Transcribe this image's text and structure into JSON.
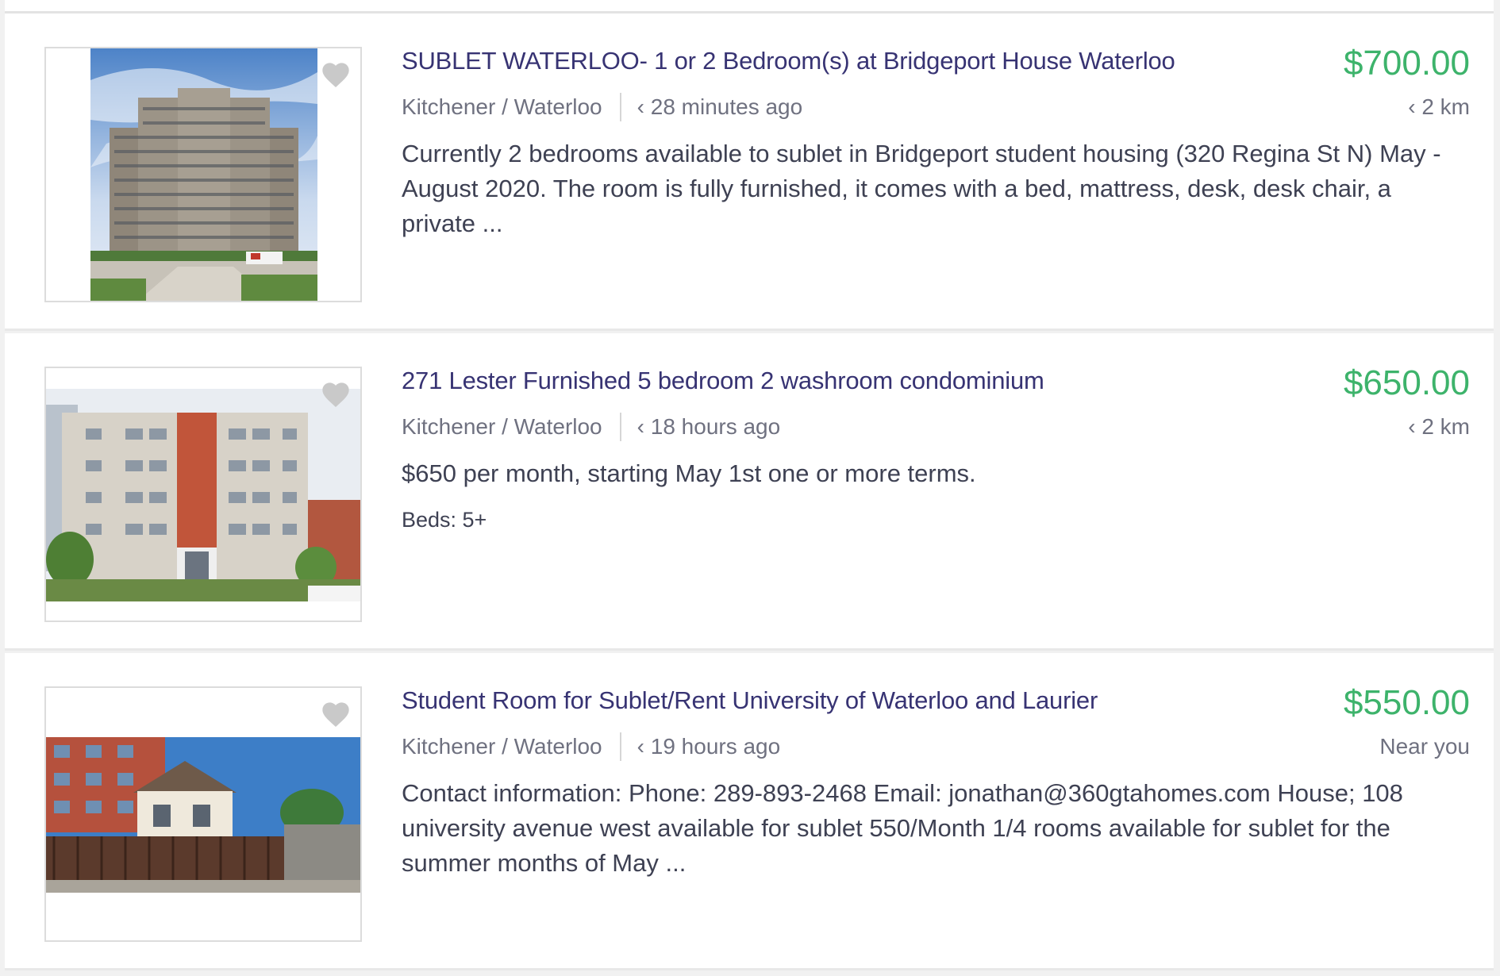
{
  "listings": [
    {
      "title": "SUBLET WATERLOO- 1 or 2 Bedroom(s) at Bridgeport House Waterloo",
      "price": "$700.00",
      "location": "Kitchener / Waterloo",
      "posted": "‹ 28 minutes ago",
      "distance": "‹ 2 km",
      "description": "Currently 2 bedrooms available to sublet in Bridgeport student housing (320 Regina St N) May - August 2020. The room is fully furnished, it comes with a bed, mattress, desk, desk chair, a private ...",
      "favorite_icon": "heart-icon"
    },
    {
      "title": "271 Lester Furnished 5 bedroom 2 washroom condominium",
      "price": "$650.00",
      "location": "Kitchener / Waterloo",
      "posted": "‹ 18 hours ago",
      "distance": "‹ 2 km",
      "description": "$650 per month, starting May 1st one or more terms.",
      "beds": "Beds: 5+",
      "favorite_icon": "heart-icon"
    },
    {
      "title": "Student Room for Sublet/Rent University of Waterloo and Laurier",
      "price": "$550.00",
      "location": "Kitchener / Waterloo",
      "posted": "‹ 19 hours ago",
      "distance": "Near you",
      "description": "Contact information: Phone: 289-893-2468 Email: jonathan@360gtahomes.com House; 108 university avenue west available for sublet 550/Month 1/4 rooms available for sublet for the summer months of May ...",
      "favorite_icon": "heart-icon"
    }
  ],
  "colors": {
    "title": "#373373",
    "price": "#3db36b",
    "meta": "#6f7180",
    "body_text": "#3e4153"
  }
}
